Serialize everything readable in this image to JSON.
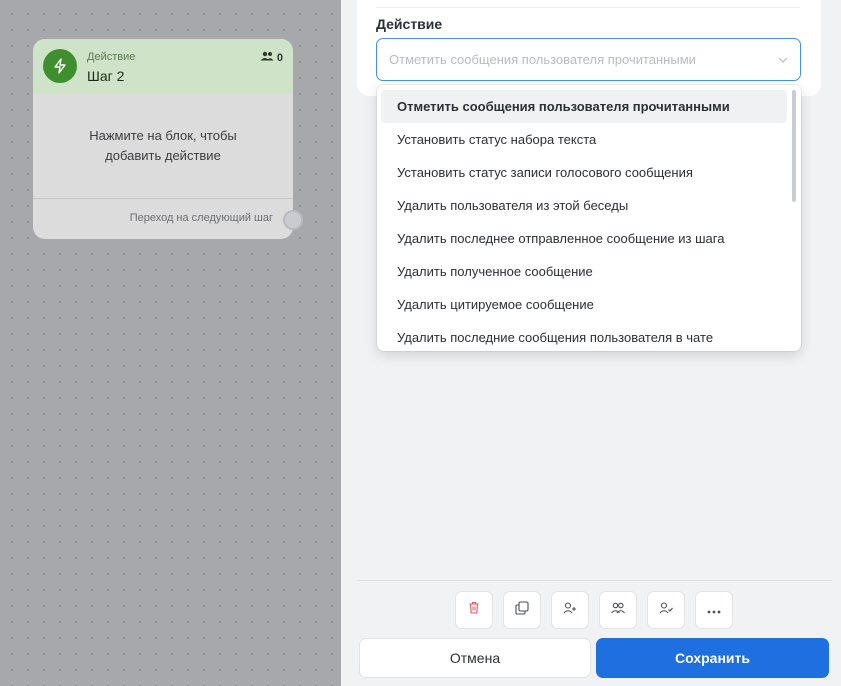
{
  "node": {
    "type_label": "Действие",
    "title": "Шаг 2",
    "user_count": "0",
    "placeholder": "Нажмите на блок, чтобы добавить действие",
    "next_step_label": "Переход на следующий шаг",
    "accent_color": "#3f8f2e"
  },
  "panel": {
    "field_label": "Действие",
    "select_placeholder": "Отметить сообщения пользователя прочитанными",
    "options": [
      "Отметить сообщения пользователя прочитанными",
      "Установить статус набора текста",
      "Установить статус записи голосового сообщения",
      "Удалить пользователя из этой беседы",
      "Удалить последнее отправленное сообщение из шага",
      "Удалить полученное сообщение",
      "Удалить цитируемое сообщение",
      "Удалить последние сообщения пользователя в чате"
    ],
    "selected_index": 0
  },
  "toolbar": {
    "tools": [
      "trash-icon",
      "copy-icon",
      "user-add-icon",
      "users-icon",
      "user-check-icon",
      "more-icon"
    ]
  },
  "actions": {
    "cancel_label": "Отмена",
    "save_label": "Сохранить",
    "save_color": "#1e6fe0"
  }
}
